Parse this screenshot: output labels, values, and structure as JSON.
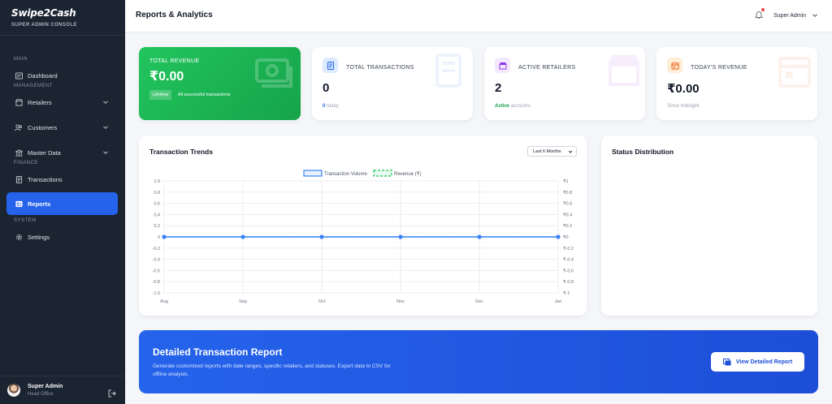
{
  "brand": {
    "name": "Swipe2Cash",
    "subtitle": "SUPER ADMIN CONSOLE"
  },
  "sidebar": {
    "sections": [
      {
        "title": "MAIN",
        "items": [
          {
            "label": "Dashboard",
            "icon": "dashboard-icon"
          }
        ]
      },
      {
        "title": "MANAGEMENT",
        "items": [
          {
            "label": "Retailers",
            "icon": "store-icon",
            "expandable": true
          },
          {
            "label": "Customers",
            "icon": "users-icon",
            "expandable": true
          },
          {
            "label": "Master Data",
            "icon": "bank-icon",
            "expandable": true
          }
        ]
      },
      {
        "title": "FINANCE",
        "items": [
          {
            "label": "Transactions",
            "icon": "receipt-icon"
          }
        ]
      },
      {
        "title": "",
        "items": [
          {
            "label": "Reports",
            "icon": "report-icon",
            "active": true
          }
        ]
      },
      {
        "title": "SYSTEM",
        "items": [
          {
            "label": "Settings",
            "icon": "gear-icon"
          }
        ]
      }
    ],
    "user": {
      "name": "Super Admin",
      "role": "Head Office"
    }
  },
  "header": {
    "title": "Reports & Analytics",
    "user": "Super Admin"
  },
  "stats": {
    "total_revenue": {
      "label": "TOTAL REVENUE",
      "value": "₹0.00",
      "pill": "Lifetime",
      "note": "All successful transactions"
    },
    "total_transactions": {
      "label": "TOTAL TRANSACTIONS",
      "value": "0",
      "sub_strong": "0",
      "sub": "today"
    },
    "active_retailers": {
      "label": "ACTIVE RETAILERS",
      "value": "2",
      "sub_strong": "Active",
      "sub": "accounts"
    },
    "todays_revenue": {
      "label": "TODAY'S REVENUE",
      "value": "₹0.00",
      "sub": "Since midnight"
    }
  },
  "trends": {
    "title": "Transaction Trends",
    "range": "Last 6 Months"
  },
  "status": {
    "title": "Status Distribution"
  },
  "banner": {
    "title": "Detailed Transaction Report",
    "description": "Generate customized reports with date ranges, specific retailers, and statuses. Export data to CSV for offline analysis.",
    "button": "View Detailed Report"
  },
  "colors": {
    "accent": "#2563eb",
    "success": "#22c55e",
    "sidebar": "#1b2431"
  },
  "chart_data": {
    "type": "line",
    "title": "Transaction Trends",
    "categories": [
      "Aug",
      "Sep",
      "Oct",
      "Nov",
      "Dec",
      "Jan"
    ],
    "series": [
      {
        "name": "Transaction Volume",
        "values": [
          0,
          0,
          0,
          0,
          0,
          0
        ],
        "axis": "left",
        "color": "#3b82f6"
      },
      {
        "name": "Revenue (₹)",
        "values": [
          0,
          0,
          0,
          0,
          0,
          0
        ],
        "axis": "right",
        "color": "#22c55e"
      }
    ],
    "ylim": [
      -1,
      1
    ],
    "y_ticks": [
      "1.0",
      "0.8",
      "0.6",
      "0.4",
      "0.2",
      "0",
      "-0.2",
      "-0.4",
      "-0.6",
      "-0.8",
      "-1.0"
    ],
    "y2_ticks": [
      "₹1",
      "₹0.8",
      "₹0.6",
      "₹0.4",
      "₹0.2",
      "₹0",
      "₹-0.2",
      "₹-0.4",
      "₹-0.6",
      "₹-0.8",
      "₹-1"
    ],
    "legend": "top-center",
    "grid": true
  }
}
